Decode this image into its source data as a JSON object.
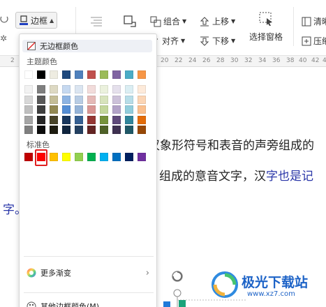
{
  "toolbar": {
    "border_label": "边框",
    "group_label": "组合",
    "align_label": "对齐",
    "bring_up_label": "上移",
    "send_down_label": "下移",
    "selection_pane_label": "选择窗格",
    "clear_label": "清晰",
    "compress_label": "压缩",
    "ruler_numbers": [
      "2",
      "20",
      "22",
      "24",
      "26",
      "28",
      "30",
      "32",
      "34",
      "36",
      "38",
      "40",
      "42",
      "44"
    ]
  },
  "document": {
    "line1_start": "汉",
    "line1_rest": "象形符号和表音的声旁组成的",
    "line2_black": "组成的意音文字，汉",
    "line2_blue": "字也是记",
    "line2_end": "字。"
  },
  "menu": {
    "no_border_label": "无边框颜色",
    "theme_section": "主题颜色",
    "standard_section": "标准色",
    "gradient_label": "更多渐变",
    "other_label": "其他边框颜色(M)...",
    "theme_top_row": [
      "#ffffff",
      "#000000",
      "#eeece1",
      "#1f497d",
      "#4f81bd",
      "#c0504d",
      "#9bbb59",
      "#8064a2",
      "#4bacc6",
      "#f79646"
    ],
    "theme_shades": [
      [
        "#f2f2f2",
        "#7f7f7f",
        "#ddd9c3",
        "#c6d9f0",
        "#dbe5f1",
        "#f2dcdb",
        "#ebf1dd",
        "#e5e0ec",
        "#dbeef3",
        "#fdeada"
      ],
      [
        "#d8d8d8",
        "#595959",
        "#c4bd97",
        "#8db3e2",
        "#b8cce4",
        "#e5b9b7",
        "#d7e3bc",
        "#ccc1d9",
        "#b7dde8",
        "#fbd5b5"
      ],
      [
        "#bfbfbf",
        "#3f3f3f",
        "#938953",
        "#548dd4",
        "#95b3d7",
        "#d99694",
        "#c3d69b",
        "#b2a2c7",
        "#92cddc",
        "#fac08f"
      ],
      [
        "#a5a5a5",
        "#262626",
        "#494429",
        "#17365d",
        "#366092",
        "#953734",
        "#76923c",
        "#5f497a",
        "#31859b",
        "#e36c09"
      ],
      [
        "#7f7f7f",
        "#0c0c0c",
        "#1d1b10",
        "#0f243e",
        "#244061",
        "#632423",
        "#4f6128",
        "#3f3151",
        "#205867",
        "#974806"
      ]
    ],
    "standard_colors": [
      "#c00000",
      "#ff0000",
      "#ffc000",
      "#ffff00",
      "#92d050",
      "#00b050",
      "#00b0f0",
      "#0070c0",
      "#002060",
      "#7030a0"
    ],
    "selected_standard": "#ff0000"
  },
  "watermark": {
    "title": "极光下载站",
    "url": "www.xz7.com"
  }
}
